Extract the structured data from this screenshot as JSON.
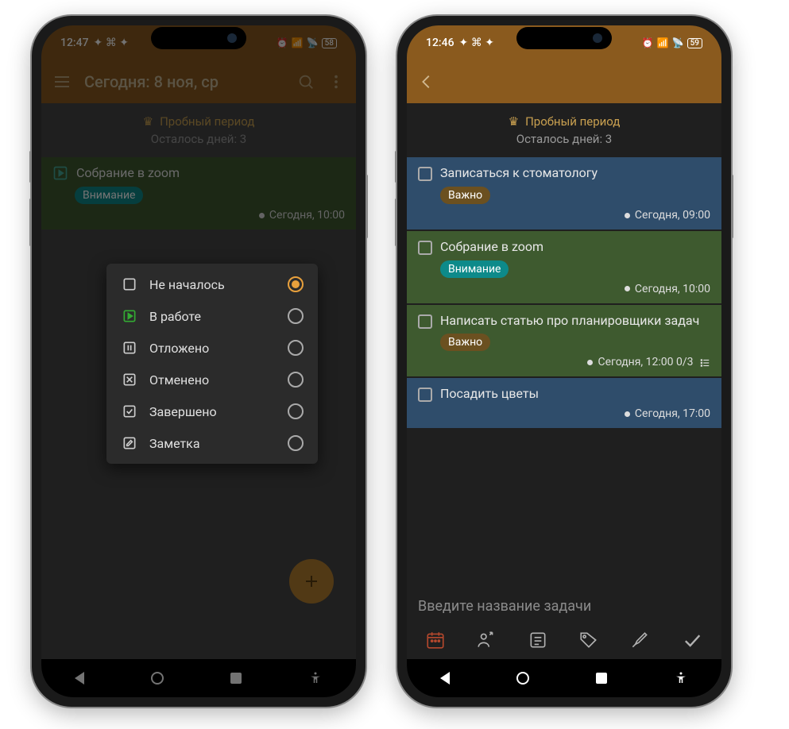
{
  "left": {
    "status_time": "12:47",
    "battery": "58",
    "appbar_title": "Сегодня: 8 ноя, ср",
    "trial_line1": "Пробный период",
    "trial_line2": "Осталось дней: 3",
    "task1_title": "Собрание в zoom",
    "task1_tag": "Внимание",
    "task1_meta": "Сегодня, 10:00",
    "popup": {
      "o1": "Не началось",
      "o2": "В работе",
      "o3": "Отложено",
      "o4": "Отменено",
      "o5": "Завершено",
      "o6": "Заметка"
    }
  },
  "right": {
    "status_time": "12:46",
    "battery": "59",
    "trial_line1": "Пробный период",
    "trial_line2": "Осталось дней: 3",
    "t1_title": "Записаться к стоматологу",
    "t1_tag": "Важно",
    "t1_meta": "Сегодня, 09:00",
    "t2_title": "Собрание в zoom",
    "t2_tag": "Внимание",
    "t2_meta": "Сегодня, 10:00",
    "t3_title": "Написать статью про планировщики задач",
    "t3_tag": "Важно",
    "t3_meta": "Сегодня, 12:00 0/3",
    "t4_title": "Посадить цветы",
    "t4_meta": "Сегодня, 17:00",
    "input_placeholder": "Введите название задачи"
  }
}
